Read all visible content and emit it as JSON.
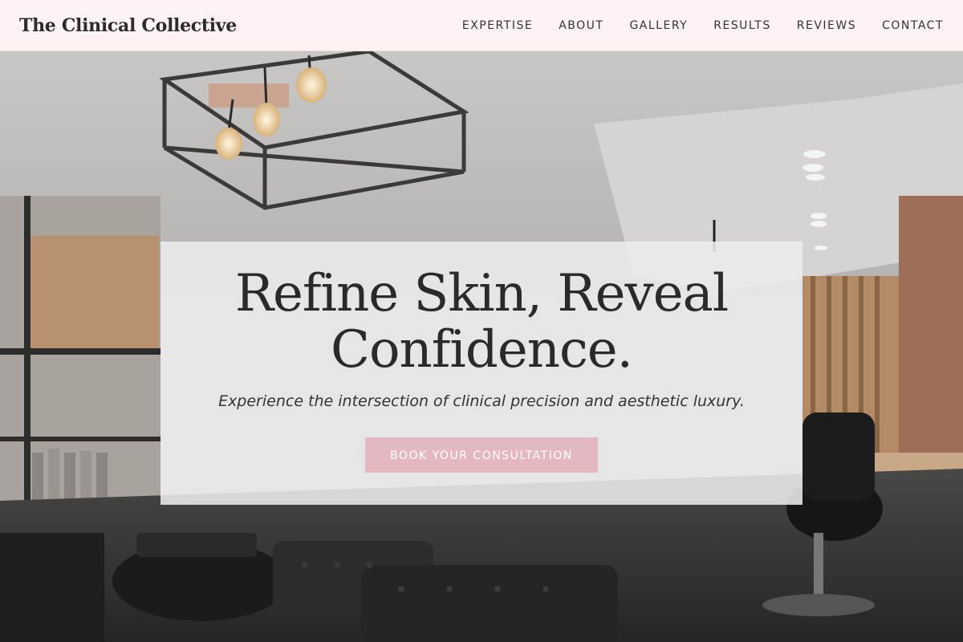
{
  "header": {
    "brand": "The Clinical Collective",
    "nav": [
      "EXPERTISE",
      "ABOUT",
      "GALLERY",
      "RESULTS",
      "REVIEWS",
      "CONTACT"
    ]
  },
  "hero": {
    "title_line1": "Refine Skin, Reveal",
    "title_line2": "Confidence.",
    "subtitle": "Experience the intersection of clinical precision and aesthetic luxury.",
    "cta_label": "BOOK YOUR CONSULTATION"
  },
  "colors": {
    "header_bg": "#fdf3f2",
    "accent": "#e3b8c0",
    "text": "#2a2a2a"
  }
}
